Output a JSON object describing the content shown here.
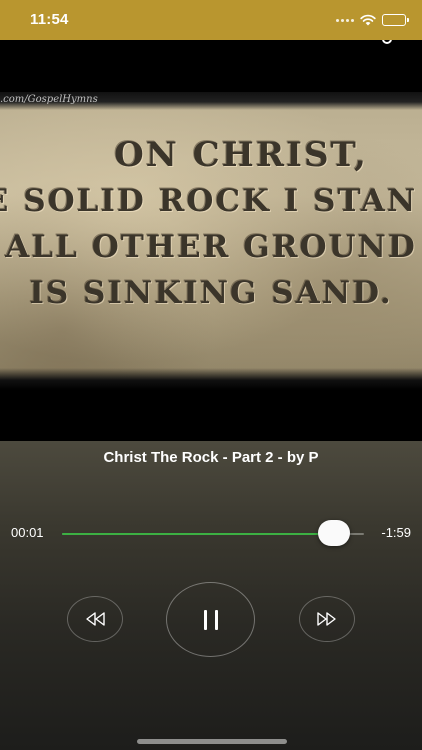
{
  "status_bar": {
    "time": "11:54",
    "icons": [
      "signal-icon",
      "wifi-icon",
      "battery-icon"
    ]
  },
  "artwork": {
    "watermark": ".com/GospelHymns",
    "lines": [
      "ON CHRIST,",
      "E SOLID ROCK I STAN",
      "ALL OTHER GROUND",
      "IS SINKING SAND."
    ]
  },
  "player": {
    "title": "Christ The Rock - Part 2 - by P",
    "elapsed": "00:01",
    "remaining": "-1:59",
    "progress_fraction": 0.9,
    "controls": {
      "rewind_icon": "rewind-icon",
      "pause_icon": "pause-icon",
      "forward_icon": "fast-forward-icon"
    }
  },
  "colors": {
    "status_bar": "#b9962f",
    "progress": "#3cb043"
  }
}
